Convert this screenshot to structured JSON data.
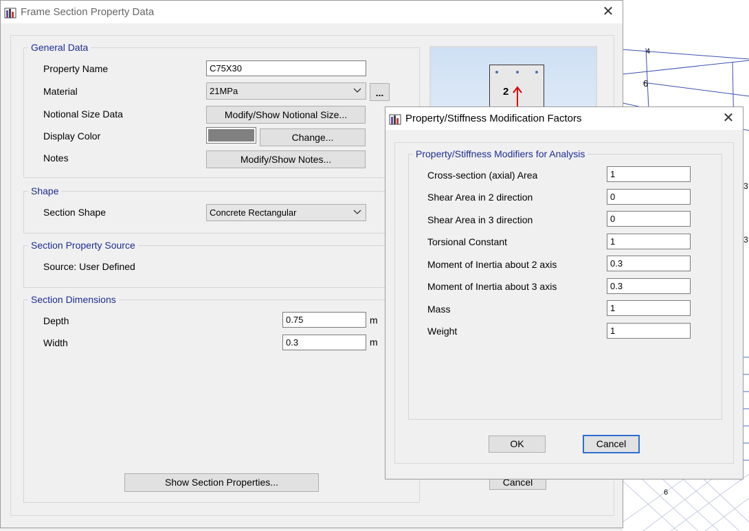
{
  "frame_dialog": {
    "title": "Frame Section Property Data",
    "close_glyph": "✕",
    "general": {
      "title": "General Data",
      "property_name_label": "Property Name",
      "property_name_value": "C75X30",
      "material_label": "Material",
      "material_value": "21MPa",
      "material_more": "...",
      "notional_label": "Notional Size Data",
      "notional_button": "Modify/Show Notional Size...",
      "color_label": "Display Color",
      "color_value": "#808080",
      "change_button": "Change...",
      "notes_label": "Notes",
      "notes_button": "Modify/Show Notes..."
    },
    "shape": {
      "title": "Shape",
      "section_shape_label": "Section Shape",
      "section_shape_value": "Concrete Rectangular"
    },
    "source": {
      "title": "Section Property Source",
      "text": "Source:  User Defined"
    },
    "dimensions": {
      "title": "Section Dimensions",
      "depth_label": "Depth",
      "depth_value": "0.75",
      "width_label": "Width",
      "width_value": "0.3",
      "unit": "m"
    },
    "preview": {
      "axis_label": "2"
    },
    "show_props_button": "Show Section Properties...",
    "cancel_button": "Cancel"
  },
  "modifiers_dialog": {
    "title": "Property/Stiffness Modification Factors",
    "close_glyph": "✕",
    "group_title": "Property/Stiffness Modifiers for Analysis",
    "rows": [
      {
        "label": "Cross-section (axial) Area",
        "value": "1"
      },
      {
        "label": "Shear Area in 2 direction",
        "value": "0"
      },
      {
        "label": "Shear Area in 3 direction",
        "value": "0"
      },
      {
        "label": "Torsional Constant",
        "value": "1"
      },
      {
        "label": "Moment of Inertia about 2 axis",
        "value": "0.3"
      },
      {
        "label": "Moment of Inertia about 3 axis",
        "value": "0.3"
      },
      {
        "label": "Mass",
        "value": "1"
      },
      {
        "label": "Weight",
        "value": "1"
      }
    ],
    "ok_button": "OK",
    "cancel_button": "Cancel"
  },
  "background_view": {
    "joint_labels": [
      "4",
      "6",
      "3",
      "3",
      "6"
    ]
  },
  "colors": {
    "group_title": "#1c2c94",
    "default_button_border": "#2a6ecf",
    "model_lines": "#3a4fb0"
  },
  "icons": {
    "app_icon": "app-icon",
    "chevron": "chevron-down-icon"
  }
}
